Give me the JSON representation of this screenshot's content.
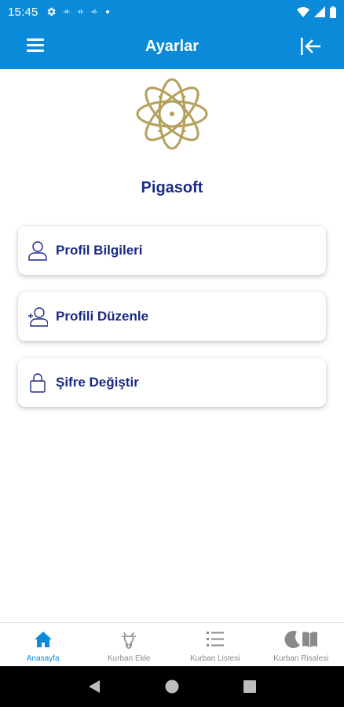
{
  "status_bar": {
    "time": "15:45",
    "notif_labels": [
      "-ıl-",
      "-ıl-",
      "-ıl-"
    ]
  },
  "app_bar": {
    "title": "Ayarlar",
    "menu_icon": "hamburger-icon",
    "logout_icon": "logout-arrow-icon"
  },
  "profile": {
    "company_name": "Pigasoft"
  },
  "menu": {
    "items": [
      {
        "label": "Profil Bilgileri",
        "icon": "user-icon"
      },
      {
        "label": "Profili Düzenle",
        "icon": "user-edit-icon"
      },
      {
        "label": "Şifre Değiştir",
        "icon": "lock-icon"
      }
    ]
  },
  "bottom_nav": {
    "items": [
      {
        "label": "Anasayfa",
        "icon": "home-icon",
        "active": true
      },
      {
        "label": "Kurban Ekle",
        "icon": "cow-icon",
        "active": false
      },
      {
        "label": "Kurban Listesi",
        "icon": "list-icon",
        "active": false
      },
      {
        "label": "Kurban Risalesi",
        "icon": "moon-book-icon",
        "active": false
      }
    ]
  },
  "colors": {
    "primary": "#0a8ad8",
    "navy": "#1b2a83",
    "gold": "#b5a05c",
    "inactive": "#8a8a8a"
  }
}
